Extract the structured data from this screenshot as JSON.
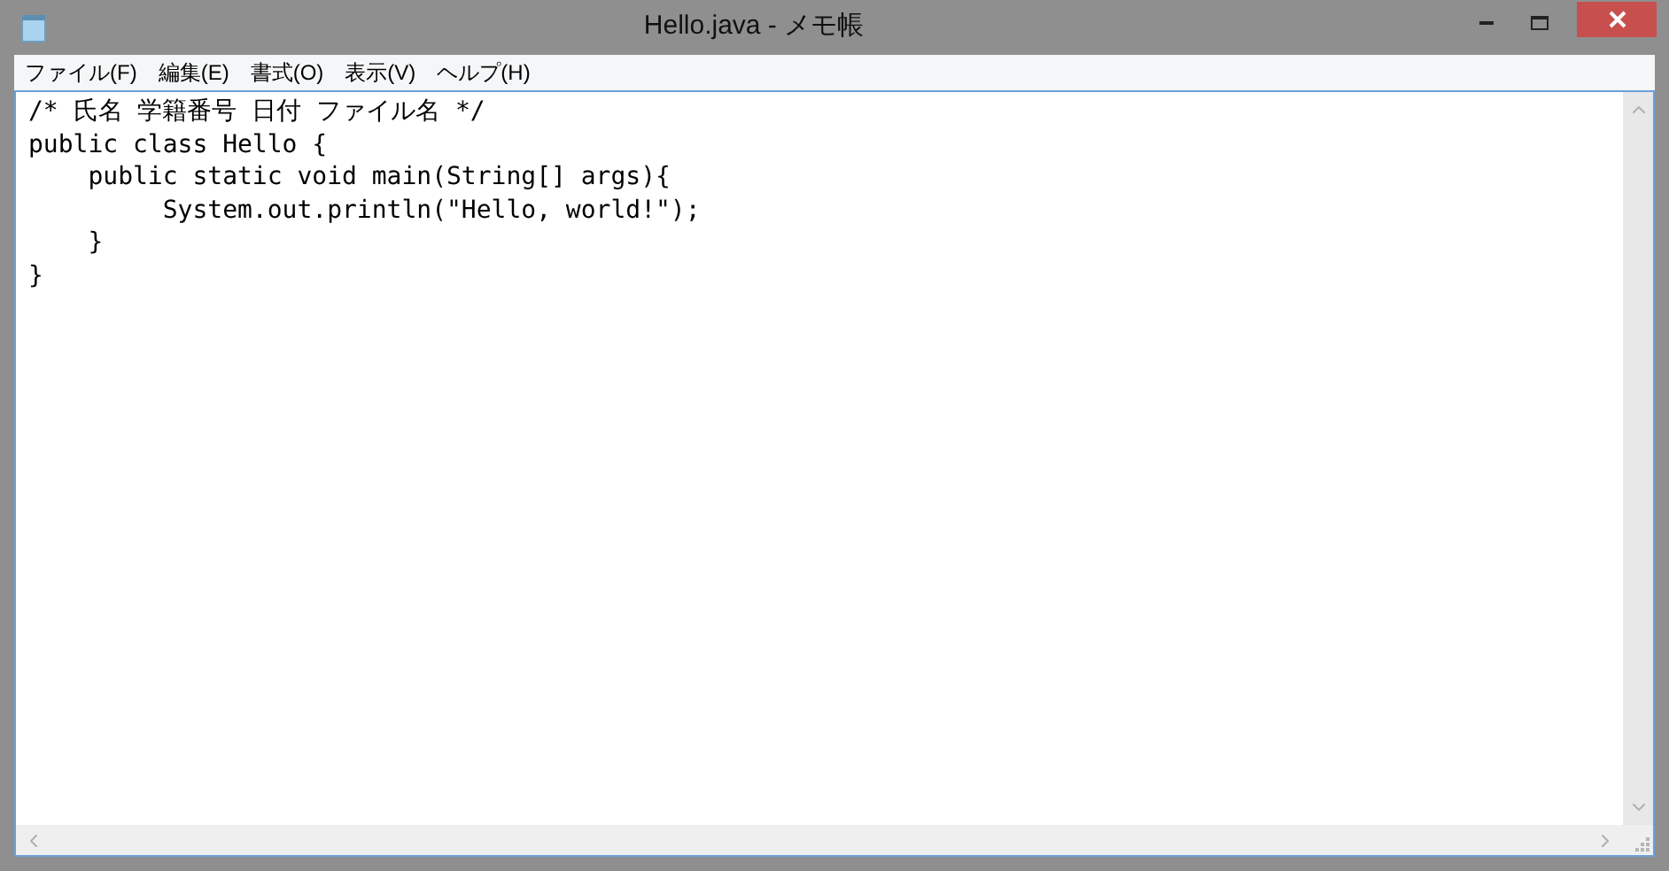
{
  "window": {
    "title": "Hello.java - メモ帳"
  },
  "menu": [
    {
      "label": "ファイル(F)"
    },
    {
      "label": "編集(E)"
    },
    {
      "label": "書式(O)"
    },
    {
      "label": "表示(V)"
    },
    {
      "label": "ヘルプ(H)"
    }
  ],
  "editor": {
    "lines": [
      "/* 氏名 学籍番号 日付 ファイル名 */",
      "public class Hello {",
      "    public static void main(String[] args){",
      "         System.out.println(\"Hello, world!\");",
      "    }",
      "}"
    ]
  }
}
